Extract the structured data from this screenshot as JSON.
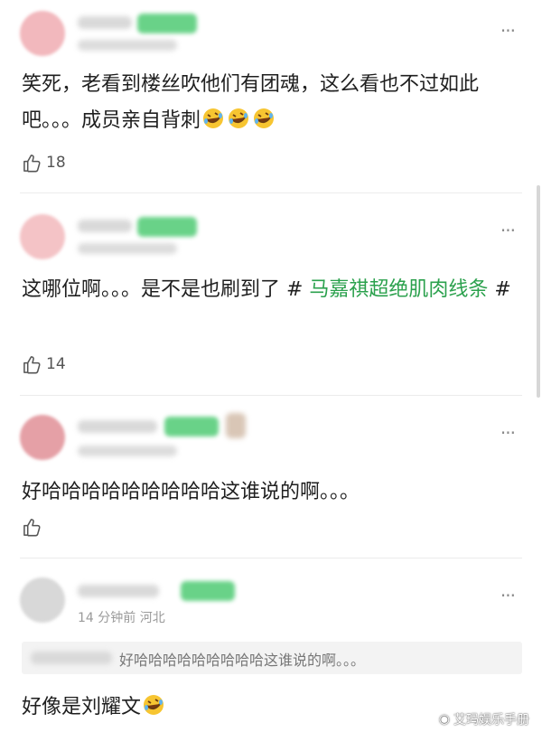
{
  "comments": [
    {
      "text": "笑死，老看到楼丝吹他们有团魂，这么看也不过如此吧。。。成员亲自背刺",
      "emoji_count": 3,
      "likes": "18",
      "avatar_color": "#f2b8bd"
    },
    {
      "text_before": "这哪位啊。。。是不是也刷到了 # ",
      "hashtag": "马嘉祺超绝肌肉线条",
      "text_after": " #",
      "likes": "14",
      "avatar_color": "#f4c3c6"
    },
    {
      "text": "好哈哈哈哈哈哈哈哈哈这谁说的啊。。。",
      "likes": "",
      "avatar_color": "#e5a0a6"
    },
    {
      "meta": "14 分钟前  河北",
      "quote": "好哈哈哈哈哈哈哈哈哈这谁说的啊。。。",
      "text": "好像是刘耀文",
      "emoji_count": 1,
      "avatar_color": "#d8d8d8"
    }
  ],
  "more_label": "···",
  "watermark": "艾玛娱乐手册",
  "colors": {
    "hashtag": "#2ba14d",
    "badge": "#4fcb74"
  }
}
